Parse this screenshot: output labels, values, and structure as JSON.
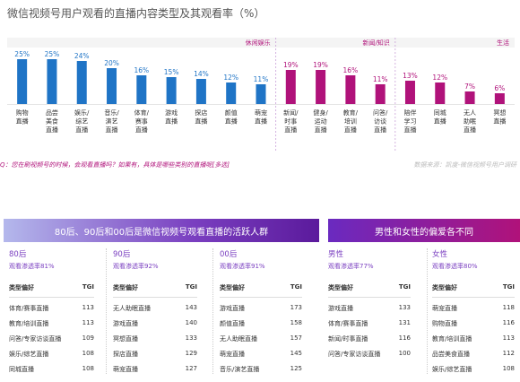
{
  "title": "微信视频号用户观看的直播内容类型及其观看率（%）",
  "question": "Q：您在刷视频号的时候，会观看直播吗？如果有，具体是哪些类别的直播呢[多选]",
  "source": "数据来源：凯度-微信视频号用户调研",
  "chart_data": {
    "type": "bar",
    "groups": [
      {
        "name": "休闲娱乐",
        "color": "#1f74c6"
      },
      {
        "name": "新闻/知识",
        "color": "#b0127a"
      },
      {
        "name": "生活",
        "color": "#b0127a"
      }
    ],
    "categories": [
      {
        "label": [
          "购物",
          "直播"
        ],
        "value": 25,
        "group": 0
      },
      {
        "label": [
          "品尝",
          "美食",
          "直播"
        ],
        "value": 25,
        "group": 0
      },
      {
        "label": [
          "娱乐/",
          "综艺",
          "直播"
        ],
        "value": 24,
        "group": 0
      },
      {
        "label": [
          "音乐/",
          "演艺",
          "直播"
        ],
        "value": 20,
        "group": 0
      },
      {
        "label": [
          "体育/",
          "赛事",
          "直播"
        ],
        "value": 16,
        "group": 0
      },
      {
        "label": [
          "游戏",
          "直播"
        ],
        "value": 15,
        "group": 0
      },
      {
        "label": [
          "探店",
          "直播"
        ],
        "value": 14,
        "group": 0
      },
      {
        "label": [
          "颜值",
          "直播"
        ],
        "value": 12,
        "group": 0
      },
      {
        "label": [
          "萌宠",
          "直播"
        ],
        "value": 11,
        "group": 0
      },
      {
        "label": [
          "新闻/",
          "时事",
          "直播"
        ],
        "value": 19,
        "group": 1
      },
      {
        "label": [
          "健身/",
          "运动",
          "直播"
        ],
        "value": 19,
        "group": 1
      },
      {
        "label": [
          "教育/",
          "培训",
          "直播"
        ],
        "value": 16,
        "group": 1
      },
      {
        "label": [
          "问答/",
          "访谈",
          "直播"
        ],
        "value": 11,
        "group": 1
      },
      {
        "label": [
          "陪伴",
          "学习",
          "直播"
        ],
        "value": 13,
        "group": 2
      },
      {
        "label": [
          "同城",
          "直播"
        ],
        "value": 12,
        "group": 2
      },
      {
        "label": [
          "无人",
          "助眠",
          "直播"
        ],
        "value": 7,
        "group": 2
      },
      {
        "label": [
          "冥想",
          "直播"
        ],
        "value": 6,
        "group": 2
      }
    ],
    "value_suffix": "%"
  },
  "bottom_left": {
    "title": "80后、90后和00后是微信视频号观看直播的活跃人群",
    "groups": [
      {
        "name": "80后",
        "rate": "观看渗透率81%",
        "col1": "类型偏好",
        "col2": "TGI",
        "rows": [
          [
            "体育/赛事直播",
            "113"
          ],
          [
            "教育/培训直播",
            "113"
          ],
          [
            "问答/专家访谈直播",
            "109"
          ],
          [
            "娱乐/综艺直播",
            "108"
          ],
          [
            "同城直播",
            "108"
          ]
        ]
      },
      {
        "name": "90后",
        "rate": "观看渗透率92%",
        "col1": "类型偏好",
        "col2": "TGI",
        "rows": [
          [
            "无人助眠直播",
            "143"
          ],
          [
            "游戏直播",
            "140"
          ],
          [
            "冥想直播",
            "133"
          ],
          [
            "探店直播",
            "129"
          ],
          [
            "萌宠直播",
            "127"
          ]
        ]
      },
      {
        "name": "00后",
        "rate": "观看渗透率91%",
        "col1": "类型偏好",
        "col2": "TGI",
        "rows": [
          [
            "游戏直播",
            "173"
          ],
          [
            "颜值直播",
            "158"
          ],
          [
            "无人助眠直播",
            "157"
          ],
          [
            "萌宠直播",
            "145"
          ],
          [
            "音乐/演艺直播",
            "125"
          ]
        ]
      }
    ]
  },
  "bottom_right": {
    "title": "男性和女性的偏爱各不同",
    "groups": [
      {
        "name": "男性",
        "rate": "观看渗透率77%",
        "col1": "类型偏好",
        "col2": "TGI",
        "rows": [
          [
            "游戏直播",
            "133"
          ],
          [
            "体育/赛事直播",
            "131"
          ],
          [
            "新闻/时事直播",
            "116"
          ],
          [
            "问答/专家访谈直播",
            "100"
          ]
        ]
      },
      {
        "name": "女性",
        "rate": "观看渗透率80%",
        "col1": "类型偏好",
        "col2": "TGI",
        "rows": [
          [
            "萌宠直播",
            "118"
          ],
          [
            "购物直播",
            "116"
          ],
          [
            "教育/培训直播",
            "113"
          ],
          [
            "品尝美食直播",
            "112"
          ],
          [
            "娱乐/综艺直播",
            "108"
          ]
        ]
      }
    ]
  }
}
